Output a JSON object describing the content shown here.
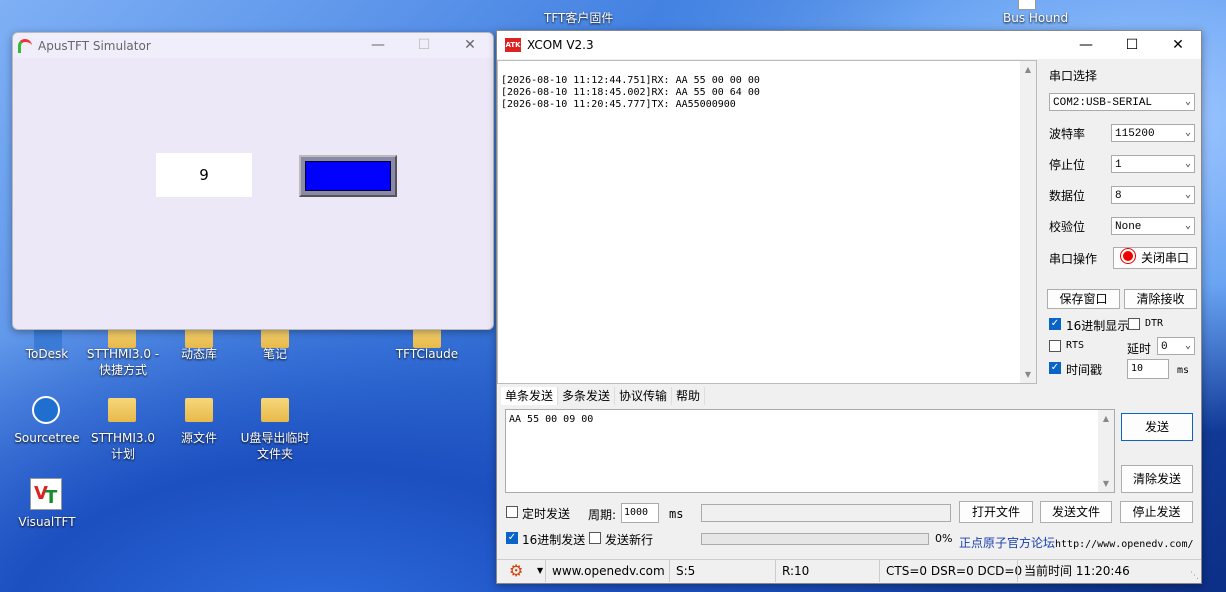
{
  "desktop": {
    "top_labels": {
      "tft_customer": "TFT客户固件",
      "bus_hound": "Bus Hound"
    },
    "icons": [
      {
        "label": "ToDesk"
      },
      {
        "label": "STTHMI3.0 -\n快捷方式"
      },
      {
        "label": "动态库"
      },
      {
        "label": "笔记"
      },
      {
        "label": "TFTClaude"
      },
      {
        "label": "Sourcetree"
      },
      {
        "label": "STTHMI3.0\n计划"
      },
      {
        "label": "源文件"
      },
      {
        "label": "U盘导出临时\n文件夹"
      },
      {
        "label": "VisualTFT"
      }
    ]
  },
  "apus": {
    "title": "ApusTFT Simulator",
    "display_value": "9",
    "button_color": "#0000ff"
  },
  "xcom": {
    "title": "XCOM V2.3",
    "log": [
      "[2026-08-10 11:12:44.751]RX: AA 55 00 00 00",
      "[2026-08-10 11:18:45.002]RX: AA 55 00 64 00",
      "[2026-08-10 11:20:45.777]TX: AA55000900"
    ],
    "settings": {
      "port_label": "串口选择",
      "port_value": "COM2:USB-SERIAL",
      "baud_label": "波特率",
      "baud_value": "115200",
      "stop_label": "停止位",
      "stop_value": "1",
      "data_label": "数据位",
      "data_value": "8",
      "parity_label": "校验位",
      "parity_value": "None",
      "op_label": "串口操作",
      "close_port": "关闭串口",
      "save_window": "保存窗口",
      "clear_recv": "清除接收",
      "hex_display": "16进制显示",
      "dtr": "DTR",
      "rts": "RTS",
      "delay_label": "延时",
      "delay_value": "0",
      "timestamp": "时间戳",
      "timestamp_value": "10",
      "ms": "ms"
    },
    "tabs": [
      "单条发送",
      "多条发送",
      "协议传输",
      "帮助"
    ],
    "send_text": "AA 55 00 09 00",
    "send_btn": "发送",
    "clear_send_btn": "清除发送",
    "timed_send": "定时发送",
    "period_label": "周期:",
    "period_value": "1000",
    "period_unit": "ms",
    "open_file": "打开文件",
    "send_file": "发送文件",
    "stop_send": "停止发送",
    "hex_send": "16进制发送",
    "send_newline": "发送新行",
    "progress": "0%",
    "forum_text": "正点原子官方论坛",
    "forum_url": "http://www.openedv.com/",
    "status": {
      "url": "www.openedv.com",
      "s": "S:5",
      "r": "R:10",
      "lines": "CTS=0 DSR=0 DCD=0",
      "time": "当前时间 11:20:46"
    }
  }
}
